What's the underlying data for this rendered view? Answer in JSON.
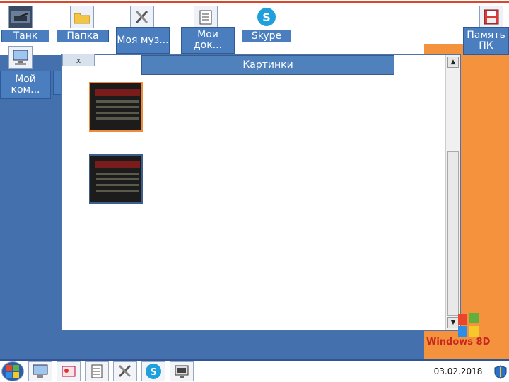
{
  "desktop": {
    "icons": [
      {
        "label": "Танк",
        "icon": "tank-picture-icon"
      },
      {
        "label": "Папка",
        "icon": "folder-icon"
      },
      {
        "label": "Моя муз...",
        "icon": "music-tools-icon"
      },
      {
        "label": "Мои док...",
        "icon": "documents-icon"
      },
      {
        "label": "Skype",
        "icon": "skype-icon"
      },
      {
        "label": "Память ПК",
        "icon": "floppy-disk-icon"
      },
      {
        "label": "Мой ком...",
        "icon": "computer-icon"
      }
    ]
  },
  "window": {
    "title": "Картинки",
    "close_label": "x"
  },
  "taskbar": {
    "date": "03.02.2018",
    "logo_text": "Windows 8D"
  },
  "colors": {
    "title_bar": "#4f81bd",
    "desktop_blue": "#4470ad",
    "desktop_orange": "#f4923e",
    "selected_border": "#f08a3c"
  }
}
